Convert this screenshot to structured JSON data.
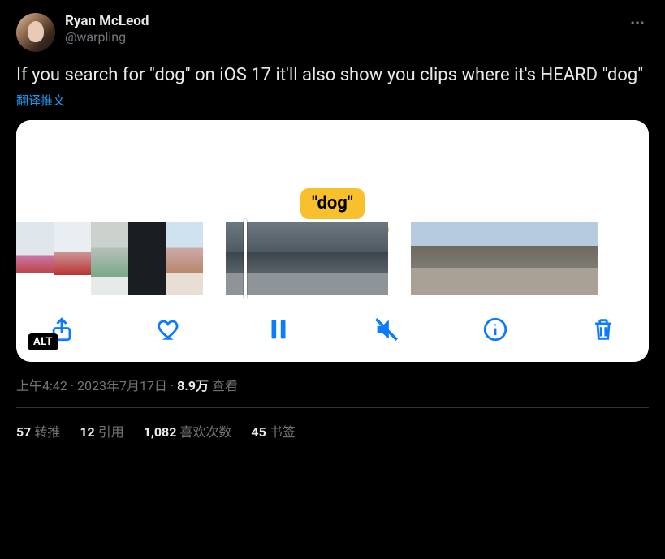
{
  "user": {
    "display_name": "Ryan McLeod",
    "handle": "@warpling"
  },
  "tweet_text": "If you search for \"dog\" on iOS 17 it'll also show you clips where it's HEARD \"dog\"",
  "translate_label": "翻译推文",
  "bubble_text": "\"dog\"",
  "alt_label": "ALT",
  "meta": {
    "time": "上午4:42",
    "date": "2023年7月17日",
    "views_num": "8.9万",
    "views_label": "查看"
  },
  "stats": {
    "retweets_num": "57",
    "retweets_label": "转推",
    "quotes_num": "12",
    "quotes_label": "引用",
    "likes_num": "1,082",
    "likes_label": "喜欢次数",
    "bookmarks_num": "45",
    "bookmarks_label": "书签"
  }
}
